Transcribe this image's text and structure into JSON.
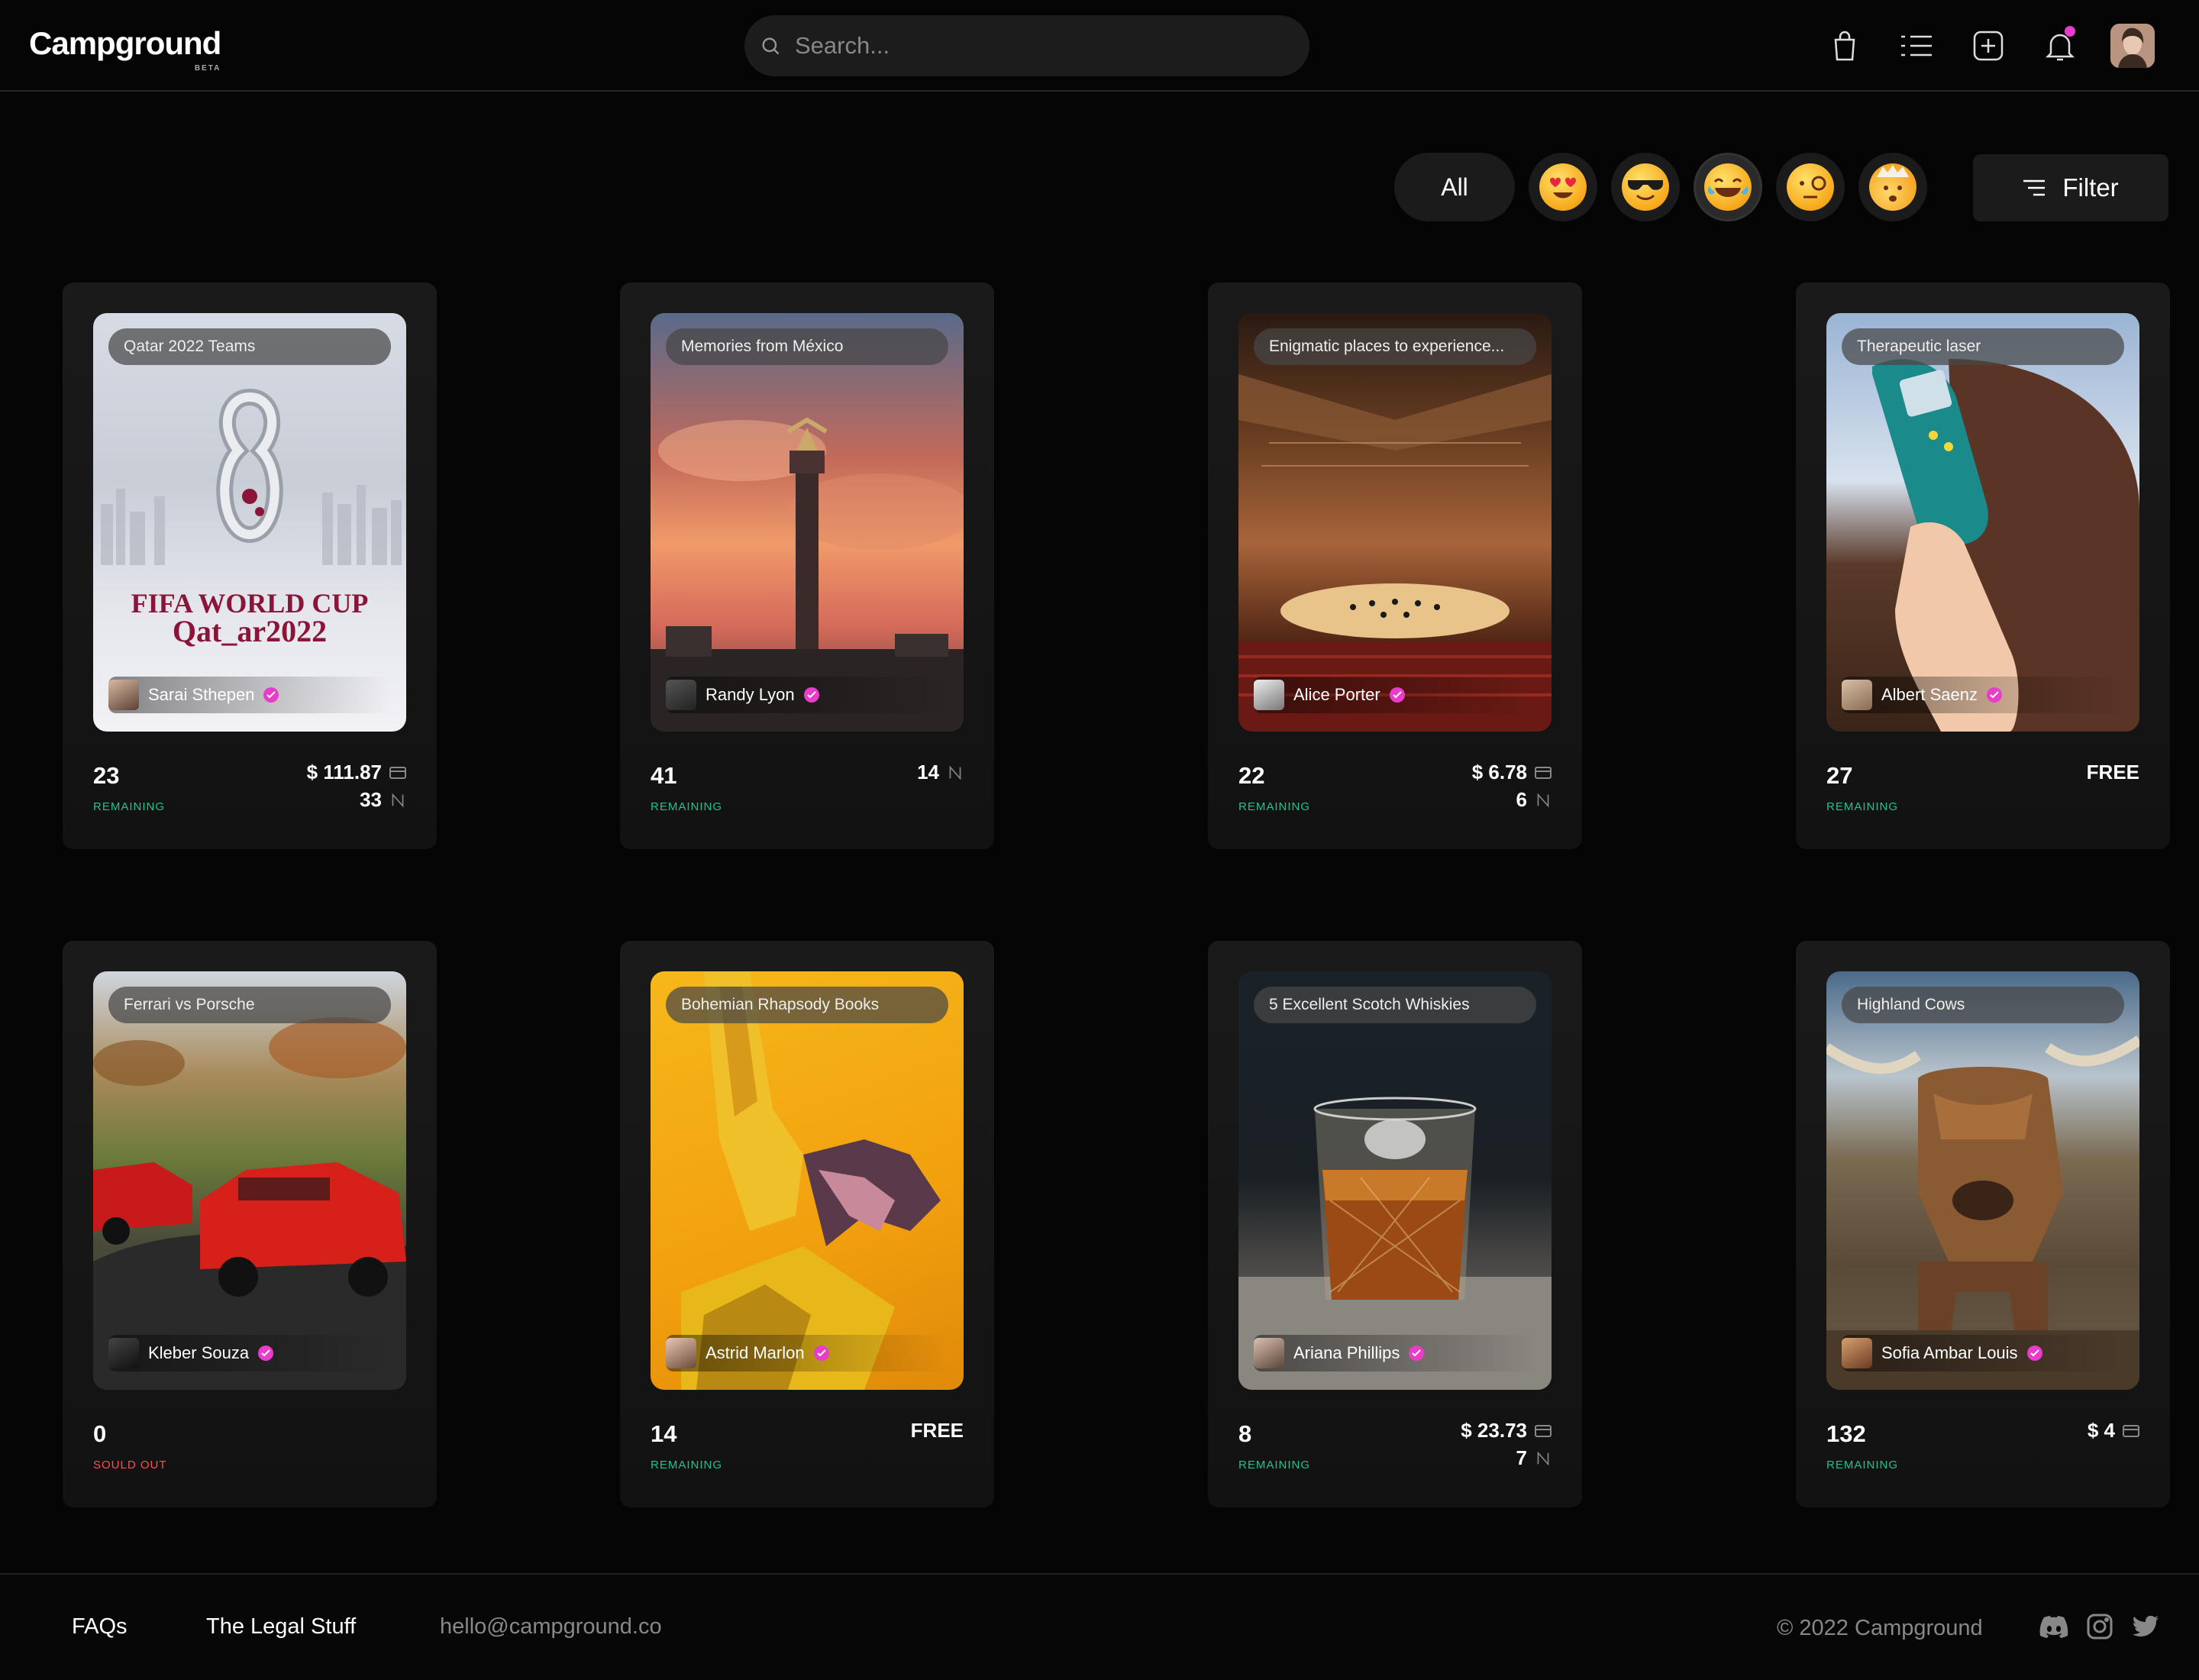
{
  "header": {
    "logo": "Campground",
    "beta": "BETA",
    "search_placeholder": "Search..."
  },
  "filters": {
    "all_label": "All",
    "emojis": [
      "heart-eyes",
      "sunglasses",
      "tears-of-joy",
      "monocle",
      "exploding-head"
    ],
    "filter_label": "Filter"
  },
  "cards": [
    {
      "tag": "Qatar 2022 Teams",
      "creator": "Sarai Sthepen",
      "count": "23",
      "status": "REMAINING",
      "price": "$ 111.87",
      "nft_count": "33",
      "poster_title1": "FIFA WORLD CUP",
      "poster_title2": "Qat_ar2022"
    },
    {
      "tag": "Memories from México",
      "creator": "Randy Lyon",
      "count": "41",
      "status": "REMAINING",
      "nft_count": "14"
    },
    {
      "tag": "Enigmatic places to experience...",
      "creator": "Alice Porter",
      "count": "22",
      "status": "REMAINING",
      "price": "$ 6.78",
      "nft_count": "6"
    },
    {
      "tag": "Therapeutic laser",
      "creator": "Albert Saenz",
      "count": "27",
      "status": "REMAINING",
      "free": "FREE"
    },
    {
      "tag": "Ferrari vs Porsche",
      "creator": "Kleber Souza",
      "count": "0",
      "status": "SOULD OUT"
    },
    {
      "tag": "Bohemian Rhapsody Books",
      "creator": "Astrid Marlon",
      "count": "14",
      "status": "REMAINING",
      "free": "FREE"
    },
    {
      "tag": "5 Excellent Scotch Whiskies",
      "creator": "Ariana Phillips",
      "count": "8",
      "status": "REMAINING",
      "price": "$ 23.73",
      "nft_count": "7"
    },
    {
      "tag": "Highland Cows",
      "creator": "Sofia Ambar Louis",
      "count": "132",
      "status": "REMAINING",
      "price": "$ 4"
    }
  ],
  "footer": {
    "faqs": "FAQs",
    "legal": "The Legal Stuff",
    "email": "hello@campground.co",
    "copyright": "© 2022 Campground"
  },
  "colors": {
    "background": "#050505",
    "card": "#161616",
    "accent_pink": "#e93cc9",
    "remaining_green": "#1fc48b",
    "sold_out_red": "#ff4f4f"
  }
}
